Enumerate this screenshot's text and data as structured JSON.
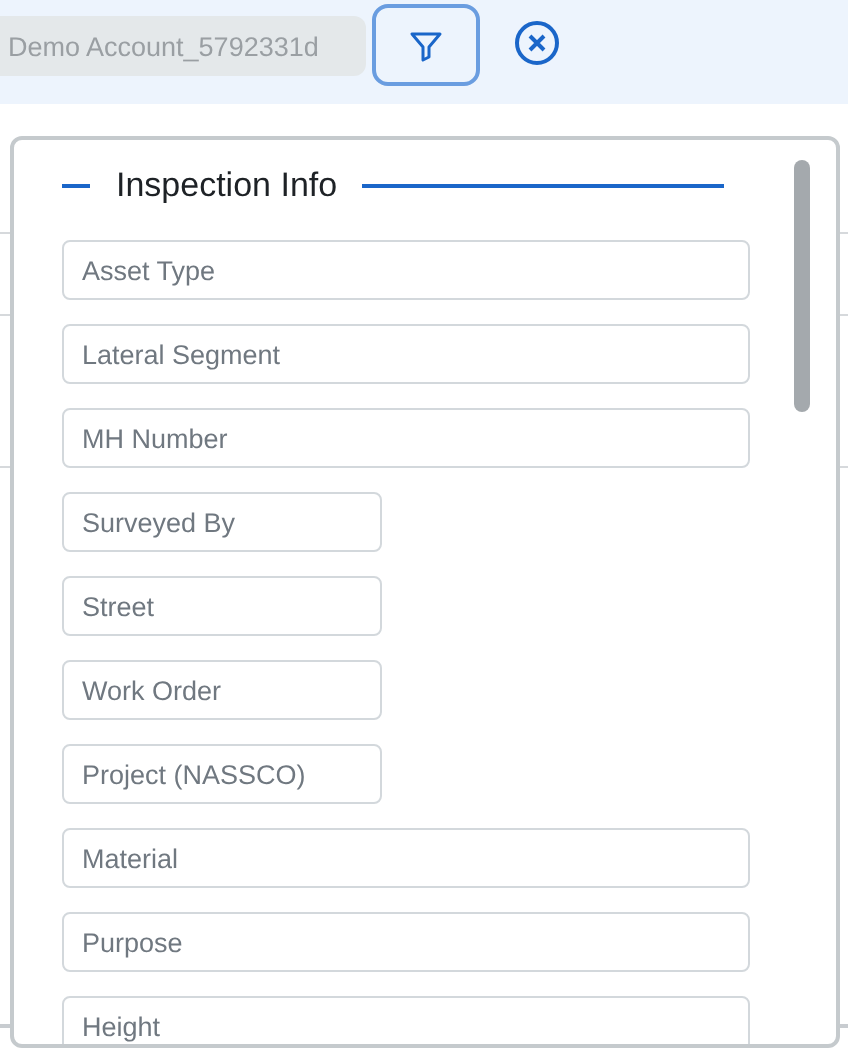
{
  "toolbar": {
    "account_field": {
      "value": "Demo Account_5792331d"
    }
  },
  "filter_panel": {
    "section_title": "Inspection Info",
    "fields": [
      {
        "placeholder": "Asset Type",
        "kind": "wide"
      },
      {
        "placeholder": "Lateral Segment",
        "kind": "wide"
      },
      {
        "placeholder": "MH Number",
        "kind": "wide"
      },
      {
        "placeholder": "Surveyed By",
        "kind": "narrow"
      },
      {
        "placeholder": "Street",
        "kind": "narrow"
      },
      {
        "placeholder": "Work Order",
        "kind": "narrow"
      },
      {
        "placeholder": "Project (NASSCO)",
        "kind": "narrow"
      },
      {
        "placeholder": "Material",
        "kind": "wide"
      },
      {
        "placeholder": "Purpose",
        "kind": "wide"
      },
      {
        "placeholder": "Height",
        "kind": "wide"
      }
    ]
  }
}
